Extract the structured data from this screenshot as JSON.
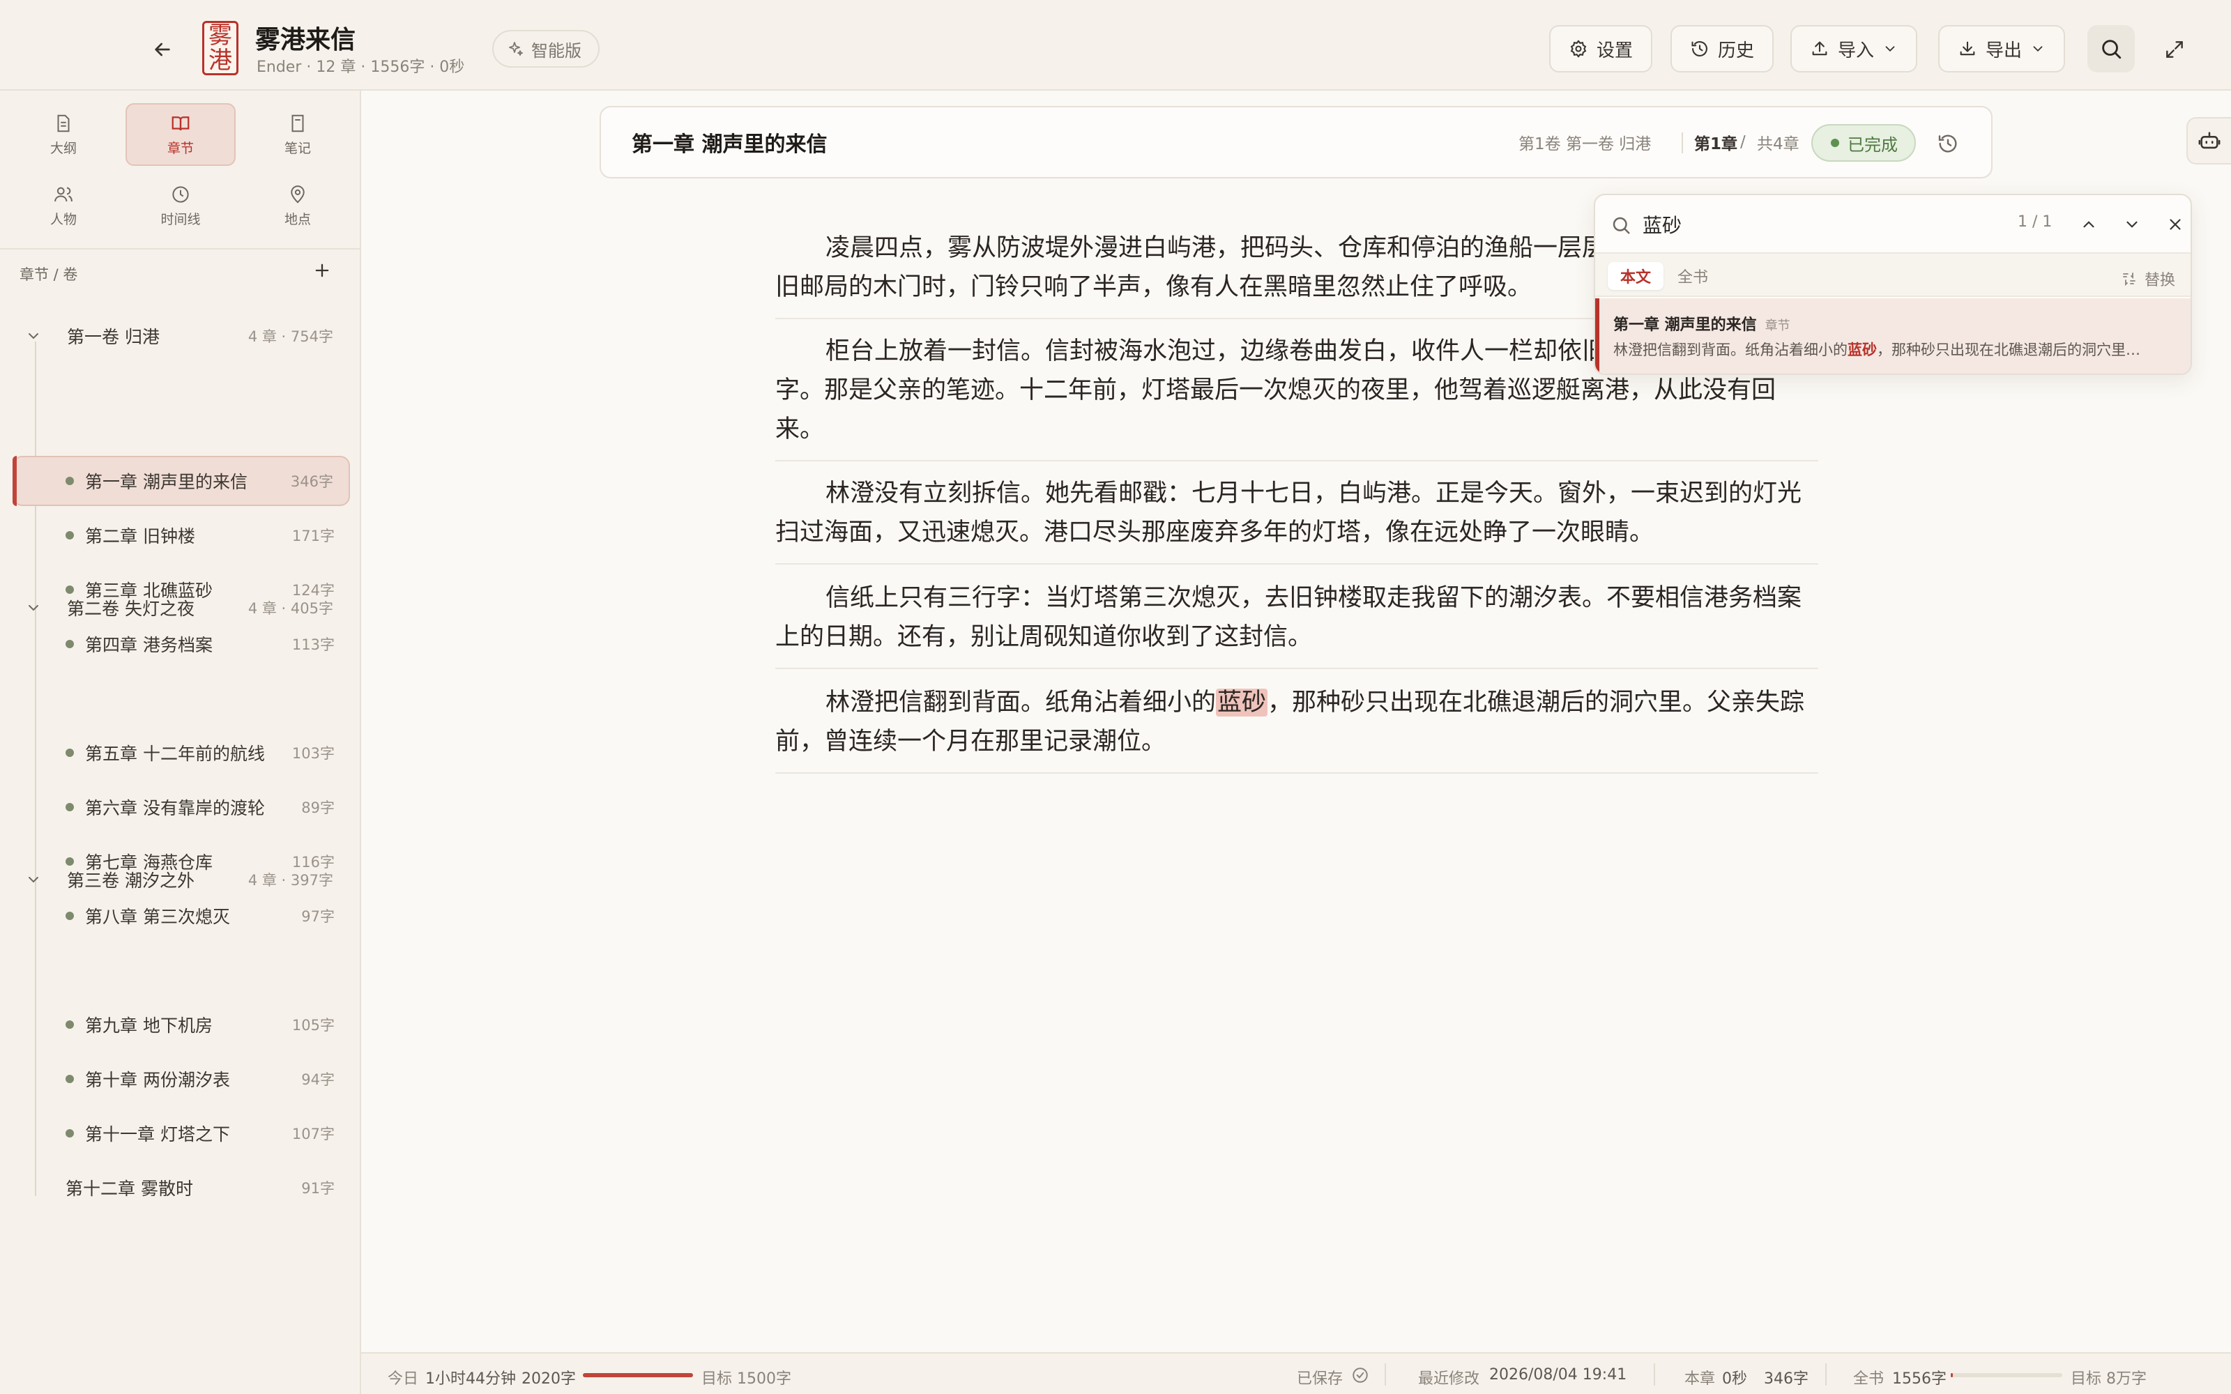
{
  "app": {
    "book_title": "雾港来信",
    "book_meta": "Ender · 12 章 · 1556字 · 0秒",
    "logo_chars": [
      "雾",
      "港"
    ],
    "smart_label": "智能版"
  },
  "toolbar": {
    "settings": "设置",
    "history": "历史",
    "import": "导入",
    "export": "导出"
  },
  "sidebar": {
    "nav": [
      {
        "label": "大纲",
        "icon": "document-icon"
      },
      {
        "label": "章节",
        "icon": "book-icon"
      },
      {
        "label": "笔记",
        "icon": "note-icon"
      },
      {
        "label": "人物",
        "icon": "people-icon"
      },
      {
        "label": "时间线",
        "icon": "clock-icon"
      },
      {
        "label": "地点",
        "icon": "location-icon"
      }
    ],
    "section_title": "章节 / 卷",
    "volumes": [
      {
        "name": "第一卷 归港",
        "meta": "4 章 · 754字",
        "chapters": [
          {
            "name": "第一章 潮声里的来信",
            "count": "346字"
          },
          {
            "name": "第二章 旧钟楼",
            "count": "171字"
          },
          {
            "name": "第三章 北礁蓝砂",
            "count": "124字"
          },
          {
            "name": "第四章 港务档案",
            "count": "113字"
          }
        ]
      },
      {
        "name": "第二卷 失灯之夜",
        "meta": "4 章 · 405字",
        "chapters": [
          {
            "name": "第五章 十二年前的航线",
            "count": "103字"
          },
          {
            "name": "第六章 没有靠岸的渡轮",
            "count": "89字"
          },
          {
            "name": "第七章 海燕仓库",
            "count": "116字"
          },
          {
            "name": "第八章 第三次熄灭",
            "count": "97字"
          }
        ]
      },
      {
        "name": "第三卷 潮汐之外",
        "meta": "4 章 · 397字",
        "chapters": [
          {
            "name": "第九章 地下机房",
            "count": "105字"
          },
          {
            "name": "第十章 两份潮汐表",
            "count": "94字"
          },
          {
            "name": "第十一章 灯塔之下",
            "count": "107字"
          },
          {
            "name": "第十二章 雾散时",
            "count": "91字"
          }
        ]
      }
    ]
  },
  "chapter_header": {
    "title": "第一章 潮声里的来信",
    "volume_no": "第1卷",
    "volume_name": "第一卷 归港",
    "chapter_no": "第1章",
    "sep": "/",
    "total": "共4章",
    "status": "已完成"
  },
  "content": {
    "p1": "凌晨四点，雾从防波堤外漫进白屿港，把码头、仓库和停泊的渔船一层层吞下去。林澄推开旧邮局的木门时，门铃只响了半声，像有人在黑暗里忽然止住了呼吸。",
    "p2": "柜台上放着一封信。信封被海水泡过，边缘卷曲发白，收件人一栏却依旧清晰地写着她的名字。那是父亲的笔迹。十二年前，灯塔最后一次熄灭的夜里，他驾着巡逻艇离港，从此没有回来。",
    "p3": "林澄没有立刻拆信。她先看邮戳：七月十七日，白屿港。正是今天。窗外，一束迟到的灯光扫过海面，又迅速熄灭。港口尽头那座废弃多年的灯塔，像在远处睁了一次眼睛。",
    "p4": "信纸上只有三行字：当灯塔第三次熄灭，去旧钟楼取走我留下的潮汐表。不要相信港务档案上的日期。还有，别让周砚知道你收到了这封信。",
    "p5_before": "林澄把信翻到背面。纸角沾着细小的",
    "p5_match": "蓝砂",
    "p5_after": "，那种砂只出现在北礁退潮后的洞穴里。父亲失踪前，曾连续一个月在那里记录潮位。"
  },
  "search": {
    "query": "蓝砂",
    "count": "1 / 1",
    "tab_current": "本文",
    "tab_book": "全书",
    "replace": "替换",
    "result_title": "第一章 潮声里的来信",
    "result_tag": "章节",
    "snippet_before": "林澄把信翻到背面。纸角沾着细小的",
    "snippet_match": "蓝砂",
    "snippet_after": "，那种砂只出现在北礁退潮后的洞穴里…"
  },
  "statusbar": {
    "today_label": "今日",
    "today_time": "1小时44分钟",
    "today_words": "2020字",
    "today_goal": "目标 1500字",
    "today_progress": 1.0,
    "saved": "已保存",
    "modified_label": "最近修改",
    "modified": "2026/08/04 19:41",
    "chapter_label": "本章",
    "chapter_time": "0秒",
    "chapter_words": "346字",
    "book_label": "全书",
    "book_words": "1556字",
    "book_goal": "目标 8万字",
    "book_progress": 0.02
  },
  "colors": {
    "accent": "#b8322a",
    "done_green": "#4f7a41",
    "bg": "#fbf9f5"
  }
}
